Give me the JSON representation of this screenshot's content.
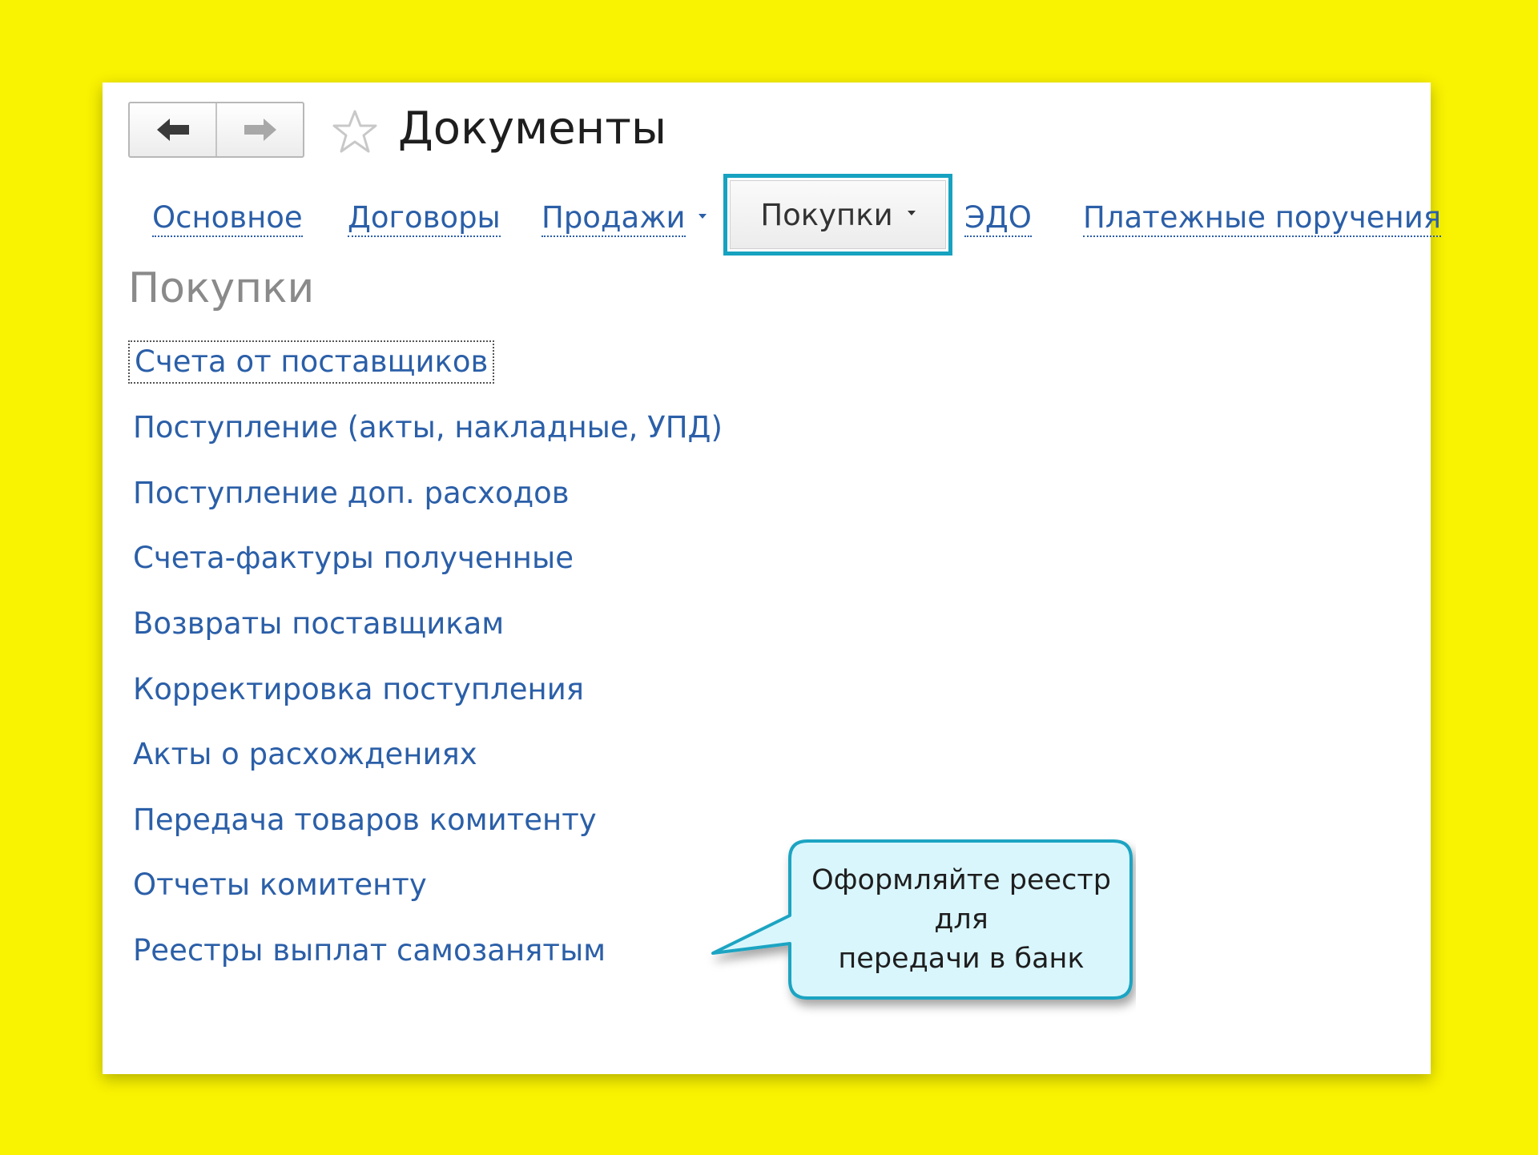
{
  "window": {
    "title": "Документы"
  },
  "toolbar": {
    "back_icon": "arrow-left-icon",
    "forward_icon": "arrow-right-icon",
    "favorite_icon": "star-icon"
  },
  "tabs": [
    {
      "label": "Основное",
      "dropdown": false
    },
    {
      "label": "Договоры",
      "dropdown": false
    },
    {
      "label": "Продажи",
      "dropdown": true
    },
    {
      "label": "Покупки",
      "dropdown": true,
      "active": true
    },
    {
      "label": "ЭДО",
      "dropdown": false
    },
    {
      "label": "Платежные поручения",
      "dropdown": false
    }
  ],
  "section": {
    "title": "Покупки",
    "links": [
      "Счета от поставщиков",
      "Поступление (акты, накладные, УПД)",
      "Поступление доп. расходов",
      "Счета-фактуры полученные",
      "Возвраты поставщикам",
      "Корректировка поступления",
      "Акты о расхождениях",
      "Передача товаров комитенту",
      "Отчеты комитенту",
      "Реестры выплат самозанятым"
    ]
  },
  "callout": {
    "text": "Оформляйте реестр для\nпередачи в банк"
  },
  "colors": {
    "background": "#f9f200",
    "link": "#2b5fa8",
    "active_tab_border": "#16a2c0",
    "callout_fill": "#d9f6fd",
    "callout_border": "#1fa4c2"
  }
}
